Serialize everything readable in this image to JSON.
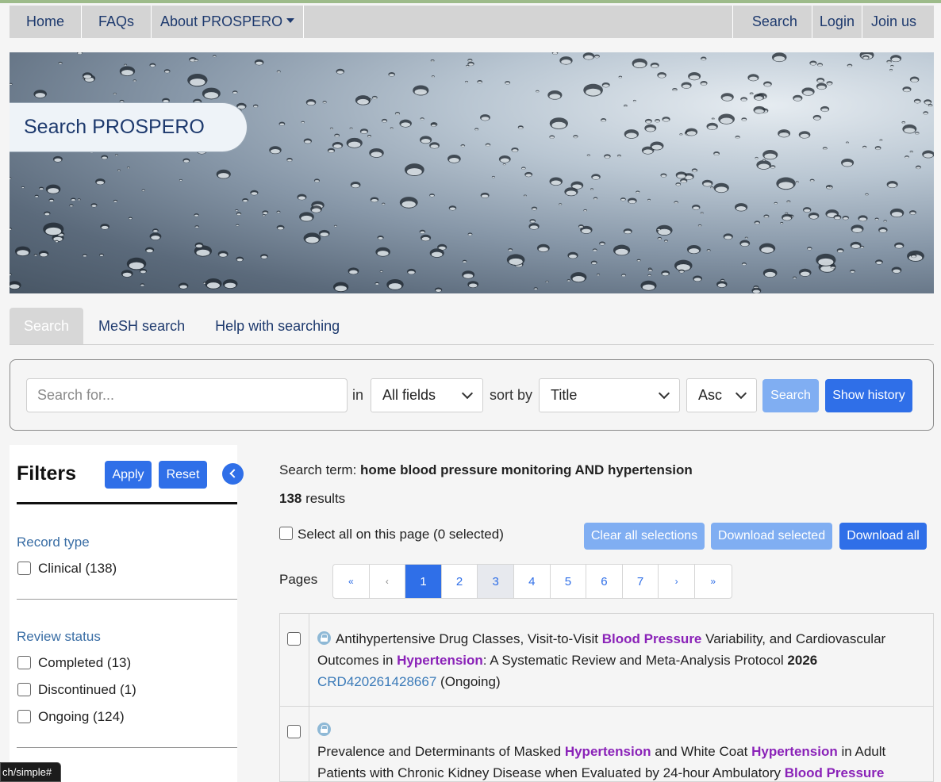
{
  "nav": {
    "home": "Home",
    "faqs": "FAQs",
    "about": "About PROSPERO",
    "search": "Search",
    "login": "Login",
    "join": "Join us"
  },
  "hero": {
    "title": "Search PROSPERO"
  },
  "tabs": [
    {
      "label": "Search",
      "active": true
    },
    {
      "label": "MeSH search",
      "active": false
    },
    {
      "label": "Help with searching",
      "active": false
    }
  ],
  "search_form": {
    "placeholder": "Search for...",
    "in_label": "in",
    "field_value": "All fields",
    "sort_label": "sort by",
    "sort_value": "Title",
    "order_value": "Asc",
    "search_button": "Search",
    "history_button": "Show history"
  },
  "filters": {
    "title": "Filters",
    "apply": "Apply",
    "reset": "Reset",
    "groups": [
      {
        "title": "Record type",
        "options": [
          "Clinical (138)"
        ]
      },
      {
        "title": "Review status",
        "options": [
          "Completed (13)",
          "Discontinued (1)",
          "Ongoing (124)"
        ]
      }
    ]
  },
  "results": {
    "term_label": "Search term:",
    "term": "home blood pressure monitoring AND hypertension",
    "count": "138",
    "count_suffix": "results",
    "select_all": "Select all on this page (0 selected)",
    "clear_selections": "Clear all selections",
    "download_selected": "Download selected",
    "download_all": "Download all",
    "pages_label": "Pages",
    "pages": [
      "«",
      "‹",
      "1",
      "2",
      "3",
      "4",
      "5",
      "6",
      "7",
      "›",
      "»"
    ],
    "current_page": "1",
    "records": [
      {
        "title_parts": [
          "Antihypertensive Drug Classes, Visit-to-Visit ",
          "Blood Pressure",
          " Variability, and Cardiovascular Outcomes in ",
          "Hypertension",
          ": A Systematic Review and Meta-Analysis Protocol "
        ],
        "year": "2026",
        "id": "CRD420261428667",
        "status": "(Ongoing)"
      },
      {
        "title_parts": [
          "Prevalence and Determinants of Masked ",
          "Hypertension",
          " and White Coat ",
          "Hypertension",
          " in Adult Patients with Chronic Kidney Disease when Evaluated by 24-hour Ambulatory ",
          "Blood Pressure"
        ]
      }
    ]
  },
  "status_url": "ch/simple#",
  "colors": {
    "primary": "#2f6fe8",
    "highlight": "#8a22b8",
    "nav_bg": "#d4d4d4",
    "link": "#1e3a6e"
  }
}
